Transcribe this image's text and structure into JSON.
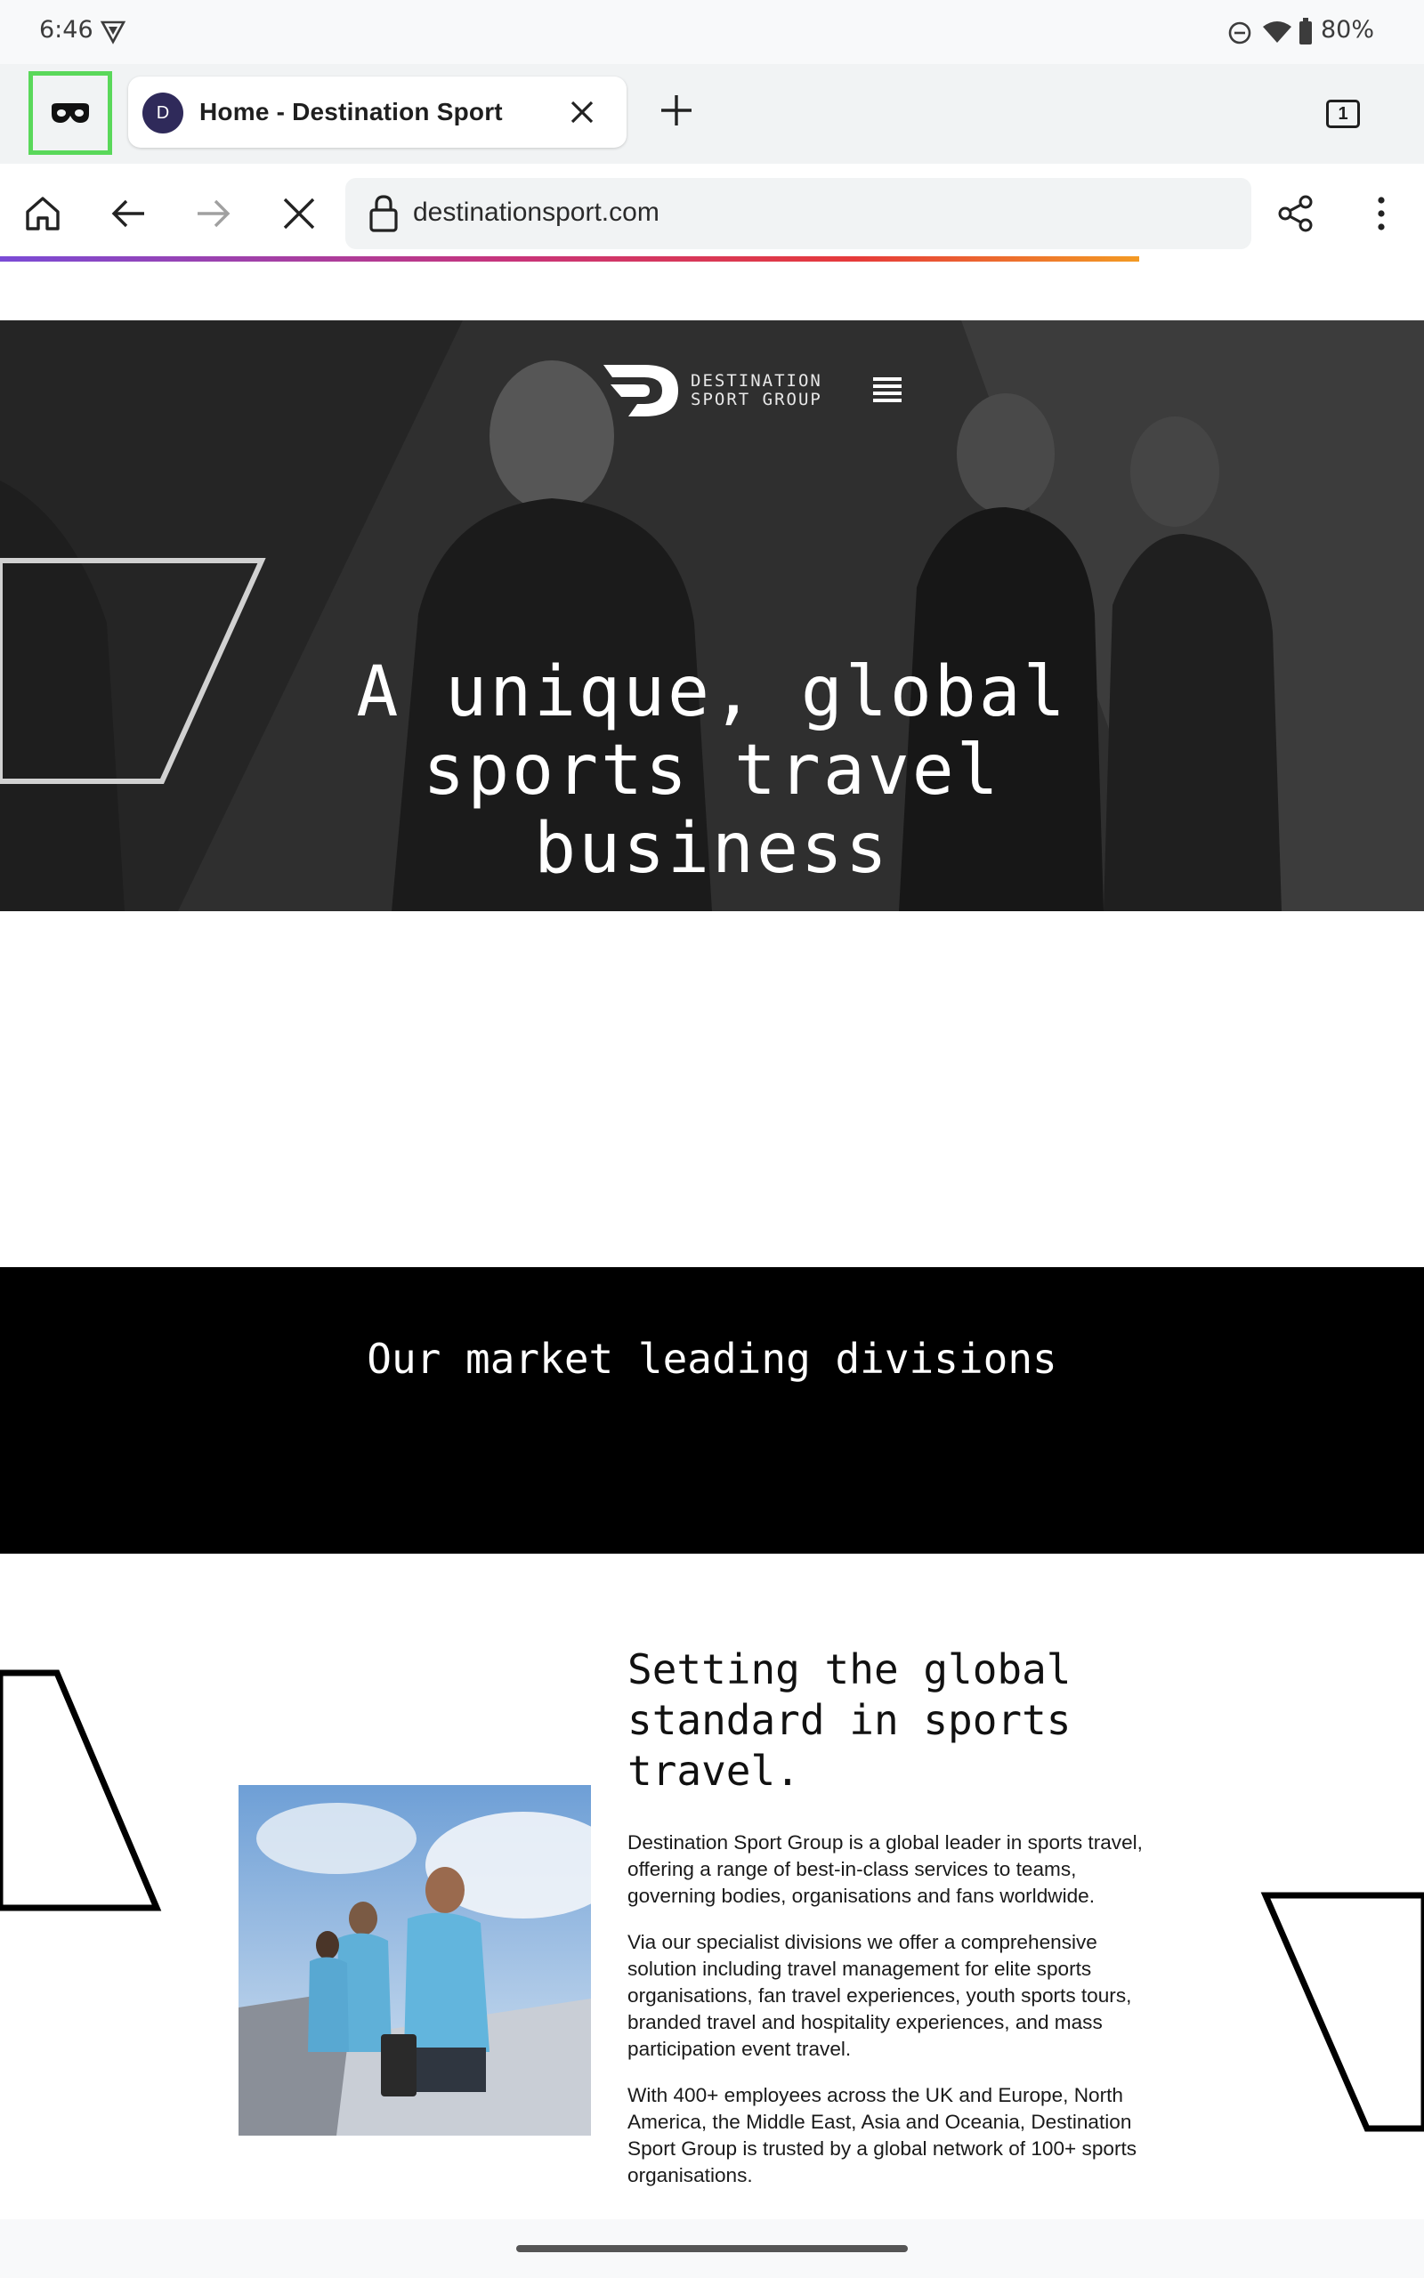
{
  "status_bar": {
    "time": "6:46",
    "battery": "80%"
  },
  "tabs": {
    "active_title": "Home - Destination Sport",
    "favicon_letter": "D",
    "count": "1"
  },
  "toolbar": {
    "url": "destinationsport.com"
  },
  "hero": {
    "logo_line1": "DESTINATION",
    "logo_line2": "SPORT GROUP",
    "heading_line1": "A unique, global",
    "heading_line2": "sports travel",
    "heading_line3": "business"
  },
  "divisions": {
    "heading": "Our market leading divisions"
  },
  "about": {
    "heading_line1": "Setting the global",
    "heading_line2": "standard in sports",
    "heading_line3": "travel.",
    "p1": "Destination Sport Group is a global leader in sports travel, offering a range of best-in-class services to teams, governing bodies, organisations and fans worldwide.",
    "p2": "Via our specialist divisions we offer a comprehensive solution including travel management for elite sports organisations, fan travel experiences, youth sports tours, branded travel and hospitality experiences, and mass participation event travel.",
    "p3": "With 400+ employees across the UK and Europe, North America, the Middle East, Asia and Oceania, Destination Sport Group is trusted by a global network of 100+ sports organisations."
  },
  "colors": {
    "private_highlight": "#5ad85a",
    "hero_bg": "#3b3b3b",
    "divisions_bg": "#000000",
    "favicon_bg": "#2f2a5a"
  },
  "icons": [
    "private-mask-icon",
    "close-icon",
    "plus-icon",
    "home-icon",
    "back-arrow-icon",
    "forward-arrow-icon",
    "stop-loading-icon",
    "lock-icon",
    "share-icon",
    "more-vert-icon",
    "hamburger-menu-icon"
  ]
}
